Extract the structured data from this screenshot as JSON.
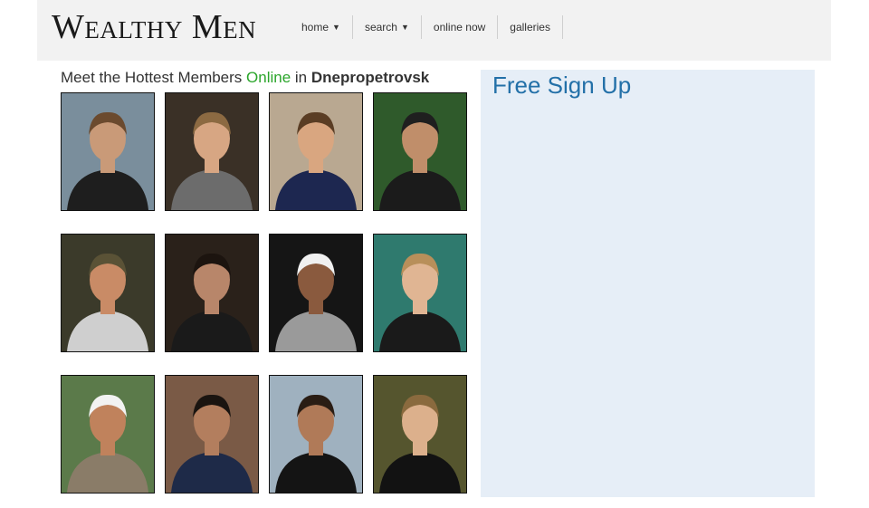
{
  "header": {
    "logo_text": "Wealthy Men",
    "nav": [
      {
        "label": "home",
        "caret": "▼"
      },
      {
        "label": "search",
        "caret": "▼"
      },
      {
        "label": "online now",
        "caret": ""
      },
      {
        "label": "galleries",
        "caret": ""
      }
    ]
  },
  "main": {
    "headline_prefix": "Meet the Hottest Members ",
    "headline_online": "Online",
    "headline_in": " in ",
    "headline_city": "Dnepropetrovsk",
    "members": [
      {
        "bg": "#7a8e9c",
        "skin": "#c99a78",
        "hair": "#6b4a2e",
        "shirt": "#1e1e1e"
      },
      {
        "bg": "#3a3026",
        "skin": "#d7a683",
        "hair": "#8c6a42",
        "shirt": "#6c6c6c"
      },
      {
        "bg": "#b9a891",
        "skin": "#d9a680",
        "hair": "#5a3d24",
        "shirt": "#1d2750"
      },
      {
        "bg": "#2f5a2b",
        "skin": "#c08e6a",
        "hair": "#1f1f1f",
        "shirt": "#1b1b1b"
      },
      {
        "bg": "#3b3a2a",
        "skin": "#c98b66",
        "hair": "#5a5236",
        "shirt": "#cfcfcf"
      },
      {
        "bg": "#2a211a",
        "skin": "#b8866a",
        "hair": "#1c140f",
        "shirt": "#1a1a1a"
      },
      {
        "bg": "#151515",
        "skin": "#8a5a3e",
        "hair": "#f0f0f0",
        "shirt": "#9a9a9a"
      },
      {
        "bg": "#2f7a6e",
        "skin": "#e0b593",
        "hair": "#b88f5a",
        "shirt": "#1a1a1a"
      },
      {
        "bg": "#5b7a4a",
        "skin": "#c0825c",
        "hair": "#f2f2f2",
        "shirt": "#8a7c68"
      },
      {
        "bg": "#7a5a46",
        "skin": "#b37e5e",
        "hair": "#1a1410",
        "shirt": "#1e2a48"
      },
      {
        "bg": "#9fb1bf",
        "skin": "#b07a58",
        "hair": "#2a1d14",
        "shirt": "#141414"
      },
      {
        "bg": "#55552e",
        "skin": "#dcb08c",
        "hair": "#8a6a3e",
        "shirt": "#121212"
      }
    ]
  },
  "signup": {
    "title": "Free Sign Up"
  }
}
